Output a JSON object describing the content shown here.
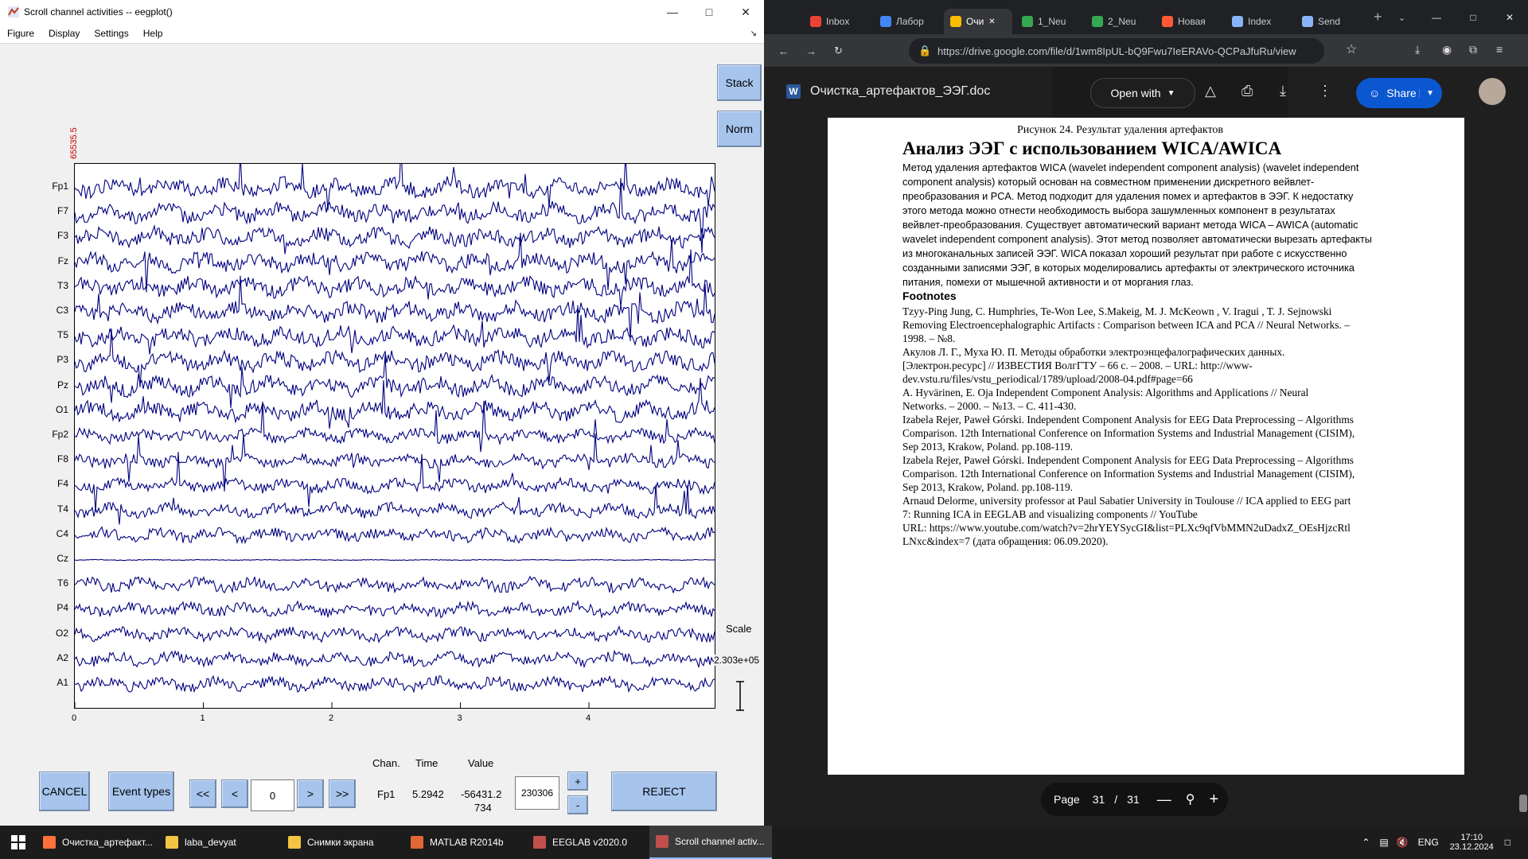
{
  "eeg_window": {
    "title": "Scroll channel activities -- eegplot()",
    "menu": [
      "Figure",
      "Display",
      "Settings",
      "Help"
    ],
    "buttons": {
      "stack": "Stack",
      "norm": "Norm",
      "cancel": "CANCEL",
      "event_types": "Event types",
      "reject": "REJECT",
      "first": "<<",
      "prev": "<",
      "next": ">",
      "last": ">>",
      "plus": "+",
      "minus": "-"
    },
    "window_position_value": "0",
    "top_scale_label": "65535.5",
    "channels": [
      "Fp1",
      "F7",
      "F3",
      "Fz",
      "T3",
      "C3",
      "T5",
      "P3",
      "Pz",
      "O1",
      "Fp2",
      "F8",
      "F4",
      "T4",
      "C4",
      "Cz",
      "T6",
      "P4",
      "O2",
      "A2",
      "A1"
    ],
    "xticks": [
      "0",
      "1",
      "2",
      "3",
      "4"
    ],
    "scale_label": "Scale",
    "scale_value": "2.303e+05",
    "info_headers": {
      "chan": "Chan.",
      "time": "Time",
      "value": "Value"
    },
    "info_values": {
      "chan": "Fp1",
      "time": "5.2942",
      "value_line1": "-56431.2",
      "value_line2": "734"
    },
    "scale_input": "230306"
  },
  "browser": {
    "tabs": [
      {
        "label": "Inbox",
        "color": "#ea4335"
      },
      {
        "label": "Лабор",
        "color": "#4285f4"
      },
      {
        "label": "Очи",
        "color": "#fbbc04",
        "active": true
      },
      {
        "label": "1_Neu",
        "color": "#34a853"
      },
      {
        "label": "2_Neu",
        "color": "#34a853"
      },
      {
        "label": "Новая",
        "color": "#ff5a36"
      },
      {
        "label": "Index",
        "color": "#8ab4f8"
      },
      {
        "label": "Send",
        "color": "#8ab4f8"
      }
    ],
    "url": "https://drive.google.com/file/d/1wm8IpUL-bQ9Fwu7IeERAVo-QCPaJfuRu/view",
    "doc_title": "Очистка_артефактов_ЭЭГ.doc",
    "open_with": "Open with",
    "share": "Share",
    "page_label": "Page",
    "page_current": "31",
    "page_sep": "/",
    "page_total": "31",
    "figure_caption": "Рисунок 24. Результат удаления артефактов",
    "heading": "Анализ ЭЭГ с использованием WICA/AWICA",
    "body_lines": [
      "Метод удаления артефактов WICA (wavelet independent component analysis) (wavelet independent",
      "component analysis) который основан на совместном применении дискретного вейвлет-",
      "преобразования и PCA. Метод подходит для удаления помех и артефактов в ЭЭГ. К недостатку",
      "этого метода можно отнести необходимость выбора зашумленных компонент в результатах",
      "вейвлет-преобразования. Существует автоматический вариант метода WICA – AWICA (automatic",
      "wavelet independent component analysis). Этот метод позволяет автоматически вырезать артефакты",
      "из многоканальных записей ЭЭГ. WICA показал хороший результат при работе с искусственно",
      "созданными записями ЭЭГ, в которых моделировались артефакты от электрического источника",
      "питания, помехи от мышечной активности и от моргания глаз."
    ],
    "footnotes_title": "Footnotes",
    "footnote_lines": [
      "Tzyy-Ping Jung, C. Humphries, Te-Won Lee, S.Makeig, M. J. McKeown , V. Iragui , T. J. Sejnowski",
      "Removing Electroencephalographic Artifacts : Comparison between ICA and PCA // Neural Networks. –",
      "1998. – №8.",
      "Акулов Л. Г., Муха Ю. П. Методы обработки электроэнцефалографических данных.",
      "[Электрон.ресурс] // ИЗВЕСТИЯ ВолгГТУ – 66 с. – 2008. – URL: http://www-",
      "dev.vstu.ru/files/vstu_periodical/1789/upload/2008-04.pdf#page=66",
      "A. Hyvärinen, E. Oja Independent Component Analysis: Algorithms and Applications // Neural",
      "Networks. – 2000. – №13. – С. 411-430.",
      "Izabela Rejer, Paweł Górski. Independent Component Analysis for EEG Data Preprocessing – Algorithms",
      "Comparison. 12th International Conference on Information Systems and Industrial Management (CISIM),",
      "Sep 2013, Krakow, Poland. pp.108-119.",
      "Izabela Rejer, Paweł Górski. Independent Component Analysis for EEG Data Preprocessing – Algorithms",
      "Comparison. 12th International Conference on Information Systems and Industrial Management (CISIM),",
      "Sep 2013, Krakow, Poland. pp.108-119.",
      "Arnaud Delorme, university professor at Paul Sabatier University in Toulouse // ICA applied to EEG part",
      "7: Running ICA in EEGLAB and visualizing components // YouTube",
      "URL: https://www.youtube.com/watch?v=2hrYEYSycGI&list=PLXc9qfVbMMN2uDadxZ_OEsHjzcRtl",
      "LNxc&index=7 (дата обращения: 06.09.2020)."
    ]
  },
  "taskbar": {
    "items": [
      {
        "label": "Очистка_артефакт...",
        "color": "#ff7139"
      },
      {
        "label": "laba_devyat",
        "color": "#f4c542"
      },
      {
        "label": "Снимки экрана",
        "color": "#f4c542"
      },
      {
        "label": "MATLAB R2014b",
        "color": "#e16737"
      },
      {
        "label": "EEGLAB v2020.0",
        "color": "#c0504d"
      },
      {
        "label": "Scroll channel activ...",
        "color": "#c0504d",
        "active": true
      }
    ],
    "lang": "ENG",
    "time": "17:10",
    "date": "23.12.2024"
  },
  "colors": {
    "trace": "#000080",
    "button": "#a6c4ec",
    "scale_label": "#cc0000",
    "share_btn": "#0b57d0"
  }
}
